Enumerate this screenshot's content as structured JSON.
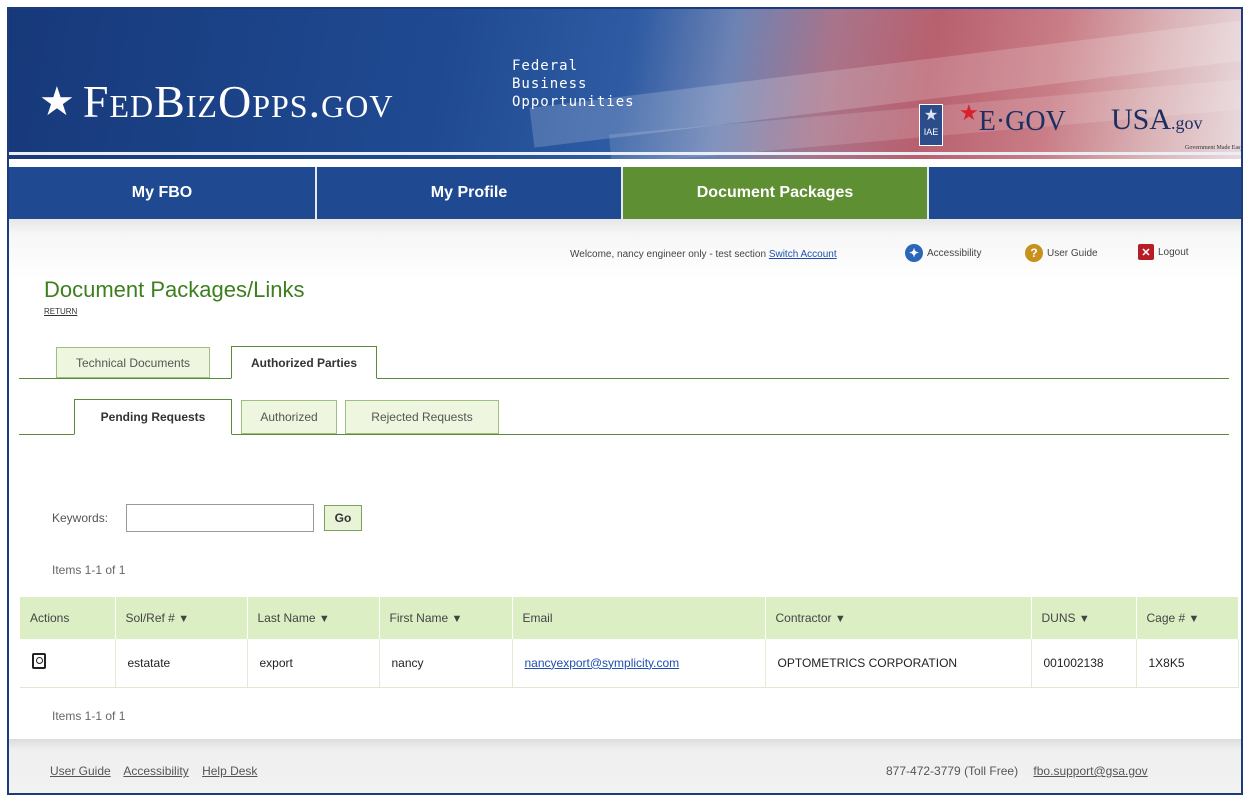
{
  "header": {
    "logo_star": "★",
    "logo_text": "FedBizOpps.gov",
    "tagline": [
      "Federal",
      "Business",
      "Opportunities"
    ],
    "iae_label": "IAE",
    "egov_label": "E·GOV",
    "usagov_label": "USA",
    "usagov_suffix": ".gov",
    "usagov_tagline": "Government Made Easy"
  },
  "nav": {
    "items": [
      {
        "label": "My FBO",
        "active": false
      },
      {
        "label": "My Profile",
        "active": false
      },
      {
        "label": "Document Packages",
        "active": true
      },
      {
        "label": "",
        "active": false
      }
    ]
  },
  "userbar": {
    "welcome_prefix": "Welcome, nancy engineer only - test section",
    "switch_account": "Switch Account",
    "accessibility": "Accessibility",
    "user_guide": "User Guide",
    "logout": "Logout"
  },
  "page": {
    "title": "Document Packages/Links",
    "return_link": "RETURN"
  },
  "tabs_primary": [
    {
      "label": "Technical Documents",
      "active": false
    },
    {
      "label": "Authorized Parties",
      "active": true
    }
  ],
  "tabs_secondary": [
    {
      "label": "Pending Requests",
      "active": true
    },
    {
      "label": "Authorized",
      "active": false
    },
    {
      "label": "Rejected Requests",
      "active": false
    }
  ],
  "search": {
    "label": "Keywords:",
    "value": "",
    "button": "Go"
  },
  "pagination": {
    "top": "Items 1-1 of 1",
    "bottom": "Items 1-1 of 1"
  },
  "table": {
    "columns": [
      {
        "label": "Actions",
        "sortable": false
      },
      {
        "label": "Sol/Ref #",
        "sortable": true
      },
      {
        "label": "Last Name",
        "sortable": true
      },
      {
        "label": "First Name",
        "sortable": true
      },
      {
        "label": "Email",
        "sortable": false
      },
      {
        "label": "Contractor",
        "sortable": true
      },
      {
        "label": "DUNS",
        "sortable": true
      },
      {
        "label": "Cage #",
        "sortable": true
      }
    ],
    "sort_arrow": "▼",
    "rows": [
      {
        "action_icon": "view-details-icon",
        "sol_ref": "estatate",
        "last_name": "export",
        "first_name": "nancy",
        "email": "nancyexport@symplicity.com",
        "contractor": "OPTOMETRICS CORPORATION",
        "duns": "001002138",
        "cage": "1X8K5"
      }
    ]
  },
  "footer": {
    "links": [
      "User Guide",
      "Accessibility",
      "Help Desk"
    ],
    "phone": "877-472-3779 (Toll Free)",
    "email": "fbo.support@gsa.gov"
  }
}
